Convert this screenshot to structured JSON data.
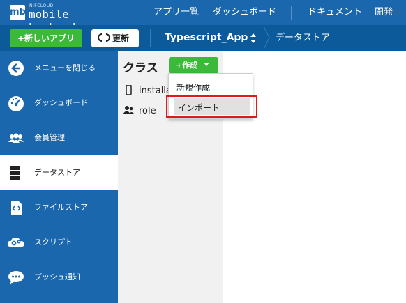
{
  "header": {
    "logo_small": "NIFCLOUD",
    "logo_mark": "mb",
    "logo_text": "mobile backend",
    "nav": [
      "アプリ一覧",
      "ダッシュボード",
      "ドキュメント",
      "開発TIPS"
    ]
  },
  "toolbar": {
    "new_app_label": "+新しいアプリ",
    "refresh_label": "更新",
    "app_name": "Typescript_App",
    "breadcrumb": "データストア"
  },
  "sidebar": {
    "items": [
      {
        "label": "メニューを閉じる",
        "icon": "arrow-left-circle-icon"
      },
      {
        "label": "ダッシュボード",
        "icon": "gauge-icon"
      },
      {
        "label": "会員管理",
        "icon": "users-icon"
      },
      {
        "label": "データストア",
        "icon": "database-icon",
        "active": true
      },
      {
        "label": "ファイルストア",
        "icon": "file-code-icon"
      },
      {
        "label": "スクリプト",
        "icon": "cloud-gear-icon"
      },
      {
        "label": "プッシュ通知",
        "icon": "chat-bubble-icon"
      }
    ]
  },
  "classes": {
    "title": "クラス",
    "create_label": "+作成",
    "items": [
      {
        "label": "installa",
        "icon": "phone-icon"
      },
      {
        "label": "role",
        "icon": "users-icon"
      }
    ]
  },
  "dropdown": {
    "items": [
      "新規作成",
      "インポート"
    ]
  },
  "colors": {
    "header_blue": "#1a67ae",
    "subbar_blue": "#0d5a9a",
    "green": "#3cb83a",
    "highlight_red": "#e01a1a"
  }
}
